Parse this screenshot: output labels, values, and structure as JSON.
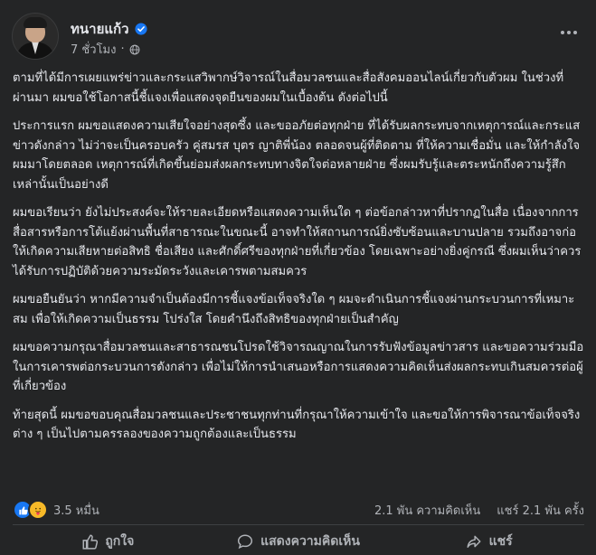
{
  "post": {
    "author": "ทนายแก้ว",
    "timestamp": "7 ชั่วโมง",
    "audience_icon": "globe-icon",
    "verified_icon": "verified-badge-icon",
    "more_icon": "more-options-icon",
    "paragraphs": [
      "ตามที่ได้มีการเผยแพร่ข่าวและกระแสวิพากษ์วิจารณ์ในสื่อมวลชนและสื่อสังคมออนไลน์เกี่ยวกับตัวผม ในช่วงที่ผ่านมา ผมขอใช้โอกาสนี้ชี้แจงเพื่อแสดงจุดยืนของผมในเบื้องต้น ดังต่อไปนี้",
      "ประการแรก ผมขอแสดงความเสียใจอย่างสุดซึ้ง และขออภัยต่อทุกฝ่าย ที่ได้รับผลกระทบจากเหตุการณ์และกระแสข่าวดังกล่าว ไม่ว่าจะเป็นครอบครัว คู่สมรส บุตร ญาติพี่น้อง ตลอดจนผู้ที่ติดตาม ที่ให้ความเชื่อมั่น และให้กำลังใจผมมาโดยตลอด เหตุการณ์ที่เกิดขึ้นย่อมส่งผลกระทบทางจิตใจต่อหลายฝ่าย ซึ่งผมรับรู้และตระหนักถึงความรู้สึกเหล่านั้นเป็นอย่างดี",
      "ผมขอเรียนว่า ยังไม่ประสงค์จะให้รายละเอียดหรือแสดงความเห็นใด ๆ ต่อข้อกล่าวหาที่ปรากฏในสื่อ เนื่องจากการสื่อสารหรือการโต้แย้งผ่านพื้นที่สาธารณะในขณะนี้ อาจทำให้สถานการณ์ยิ่งซับซ้อนและบานปลาย รวมถึงอาจก่อให้เกิดความเสียหายต่อสิทธิ ชื่อเสียง และศักดิ์ศรีของทุกฝ่ายที่เกี่ยวข้อง โดยเฉพาะอย่างยิ่งคู่กรณี ซึ่งผมเห็นว่าควรได้รับการปฏิบัติด้วยความระมัดระวังและเคารพตามสมควร",
      "ผมขอยืนยันว่า หากมีความจำเป็นต้องมีการชี้แจงข้อเท็จจริงใด ๆ ผมจะดำเนินการชี้แจงผ่านกระบวนการที่เหมาะสม เพื่อให้เกิดความเป็นธรรม โปร่งใส โดยคำนึงถึงสิทธิของทุกฝ่ายเป็นสำคัญ",
      "ผมขอความกรุณาสื่อมวลชนและสาธารณชนโปรดใช้วิจารณญาณในการรับฟังข้อมูลข่าวสาร และขอความร่วมมือในการเคารพต่อกระบวนการดังกล่าว เพื่อไม่ให้การนำเสนอหรือการแสดงความคิดเห็นส่งผลกระทบเกินสมควรต่อผู้ที่เกี่ยวข้อง",
      "ท้ายสุดนี้ ผมขอขอบคุณสื่อมวลชนและประชาชนทุกท่านที่กรุณาให้ความเข้าใจ และขอให้การพิจารณาข้อเท็จจริงต่าง ๆ เป็นไปตามครรลองของความถูกต้องและเป็นธรรม"
    ]
  },
  "stats": {
    "reaction_count": "3.5 หมื่น",
    "comments": "2.1 พัน ความคิดเห็น",
    "shares": "แชร์ 2.1 พัน ครั้ง",
    "reaction_icons": [
      "like-reaction-icon",
      "care-reaction-icon"
    ]
  },
  "actions": {
    "like": "ถูกใจ",
    "comment": "แสดงความคิดเห็น",
    "share": "แชร์"
  },
  "colors": {
    "background": "#242526",
    "text": "#e4e6eb",
    "secondary": "#b0b3b8",
    "accent": "#1877f2"
  }
}
